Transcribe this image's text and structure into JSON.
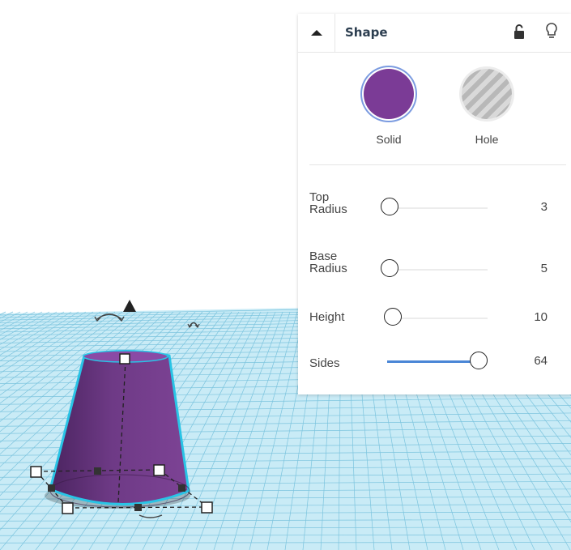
{
  "panel": {
    "title": "Shape",
    "collapse_icon": "chevron-up-icon",
    "lock_icon": "unlock-icon",
    "bulb_icon": "lightbulb-icon",
    "types": [
      {
        "label": "Solid",
        "color": "#7b3b96",
        "selected": true
      },
      {
        "label": "Hole",
        "color": "#c8c8c8",
        "selected": false
      }
    ],
    "props": [
      {
        "label": "Top\nRadius",
        "value": "3",
        "fraction": 0.0
      },
      {
        "label": "Base\nRadius",
        "value": "5",
        "fraction": 0.0
      },
      {
        "label": "Height",
        "value": "10",
        "fraction": 0.04
      },
      {
        "label": "Sides",
        "value": "64",
        "fraction": 1.0
      }
    ],
    "accent": "#4a86d6"
  },
  "shape": {
    "name": "cone",
    "color": "#7b3b96",
    "outline": "#29c4e6"
  },
  "workplane": {
    "color": "#bfe6f4",
    "grid_color": "#6fbcd8"
  }
}
